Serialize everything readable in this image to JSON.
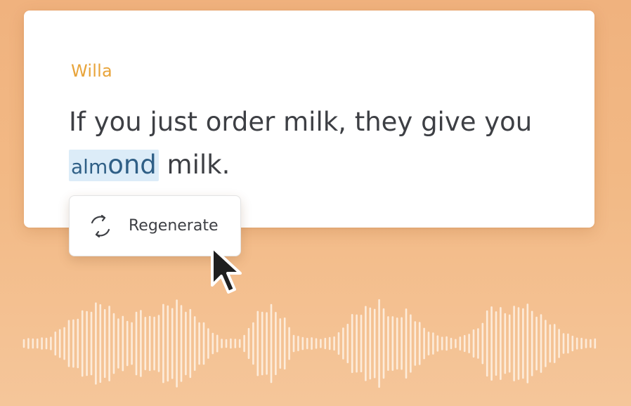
{
  "card": {
    "speaker": "Willa",
    "transcript_before": "If you just order milk, they give you",
    "highlight_small": "alm",
    "highlight_large": "ond",
    "transcript_after": " milk."
  },
  "regenerate_button": {
    "label": "Regenerate",
    "icon": "refresh-icon"
  },
  "pointer": {
    "icon": "mouse-cursor-icon"
  },
  "colors": {
    "background_top": "#f0b27e",
    "background_bottom": "#f5c69a",
    "speaker_name": "#e8a43a",
    "highlight_bg": "#dcecf8",
    "highlight_text": "#2f5f86",
    "body_text": "#3d3f44",
    "waveform": "#fff3e6"
  },
  "waveform": {
    "icon": "audio-waveform"
  }
}
